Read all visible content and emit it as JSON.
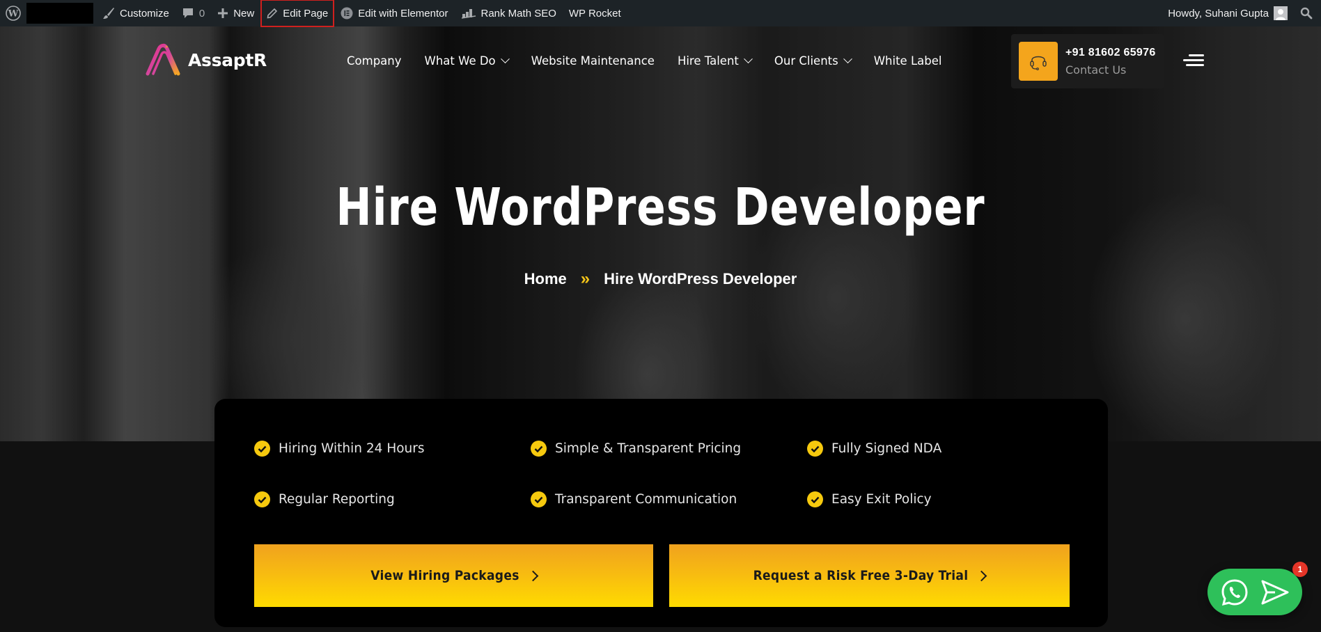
{
  "admin_bar": {
    "customize_label": "Customize",
    "comments_count": "0",
    "new_label": "New",
    "edit_page_label": "Edit Page",
    "elementor_label": "Edit with Elementor",
    "rank_math_label": "Rank Math SEO",
    "wp_rocket_label": "WP Rocket",
    "greeting": "Howdy, Suhani Gupta"
  },
  "header": {
    "logo_text": "AssaptR",
    "nav": [
      {
        "label": "Company",
        "dropdown": false
      },
      {
        "label": "What We Do",
        "dropdown": true
      },
      {
        "label": "Website Maintenance",
        "dropdown": false
      },
      {
        "label": "Hire Talent",
        "dropdown": true
      },
      {
        "label": "Our Clients",
        "dropdown": true
      },
      {
        "label": "White Label",
        "dropdown": false
      }
    ],
    "contact": {
      "phone": "+91 81602 65976",
      "label": "Contact Us"
    }
  },
  "hero": {
    "title": "Hire WordPress Developer",
    "breadcrumb": {
      "home": "Home",
      "separator": "»",
      "current": "Hire WordPress Developer"
    }
  },
  "features": [
    "Hiring Within 24 Hours",
    "Simple & Transparent Pricing",
    "Fully Signed NDA",
    "Regular Reporting",
    "Transparent Communication",
    "Easy Exit Policy"
  ],
  "cta": {
    "primary": "View Hiring Packages",
    "secondary": "Request a Risk Free 3-Day Trial"
  },
  "chat_widget": {
    "badge_count": "1"
  },
  "colors": {
    "admin_bar_bg": "#1d2327",
    "accent_yellow": "#f6c90e",
    "accent_orange": "#f4a51c",
    "whatsapp_green": "#2ec05a",
    "badge_red": "#e53528",
    "edit_page_highlight": "#d0201e"
  }
}
